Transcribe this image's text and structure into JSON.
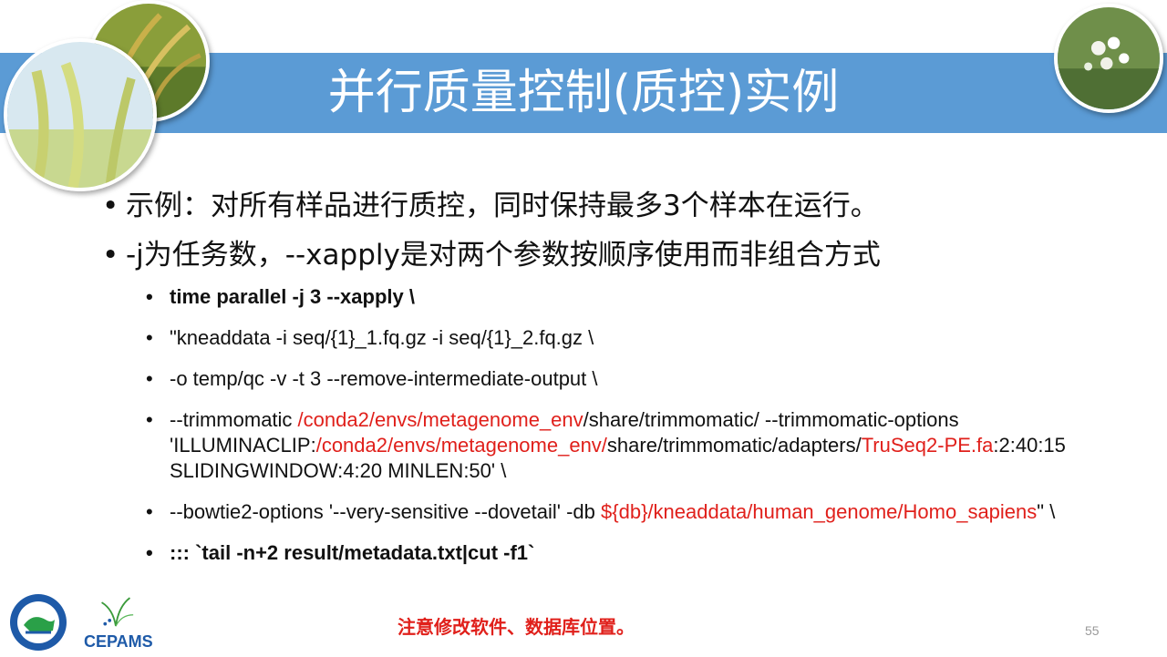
{
  "slide": {
    "title": "并行质量控制(质控)实例",
    "bullets": [
      "示例：对所有样品进行质控，同时保持最多3个样本在运行。",
      "-j为任务数，--xapply是对两个参数按顺序使用而非组合方式"
    ],
    "code": {
      "line1": "time parallel -j 3 --xapply \\",
      "line2": "  \"kneaddata -i seq/{1}_1.fq.gz -i seq/{1}_2.fq.gz \\",
      "line3": "  -o temp/qc -v -t 3 --remove-intermediate-output \\",
      "line4": {
        "p1": "  --trimmomatic ",
        "p2": "/conda2/envs/metagenome_env",
        "p3": "/share/trimmomatic/ --trimmomatic-options 'ILLUMINACLIP:",
        "p4": "/conda2/envs/metagenome_env/",
        "p5": "share/trimmomatic/adapters/",
        "p6": "TruSeq2-PE.fa",
        "p7": ":2:40:15 SLIDINGWINDOW:4:20 MINLEN:50' \\"
      },
      "line5": {
        "p1": "  --bowtie2-options '--very-sensitive --dovetail' -db ",
        "p2": "${db}/kneaddata/human_genome/Homo_sapiens",
        "p3": "\" \\"
      },
      "line6": " :::  `tail -n+2 result/metadata.txt|cut -f1`"
    },
    "note": "注意修改软件、数据库位置。",
    "page_number": "55",
    "logo_text": "CEPAMS",
    "colors": {
      "title_bar": "#5b9bd5",
      "highlight_red": "#e0201b"
    }
  }
}
